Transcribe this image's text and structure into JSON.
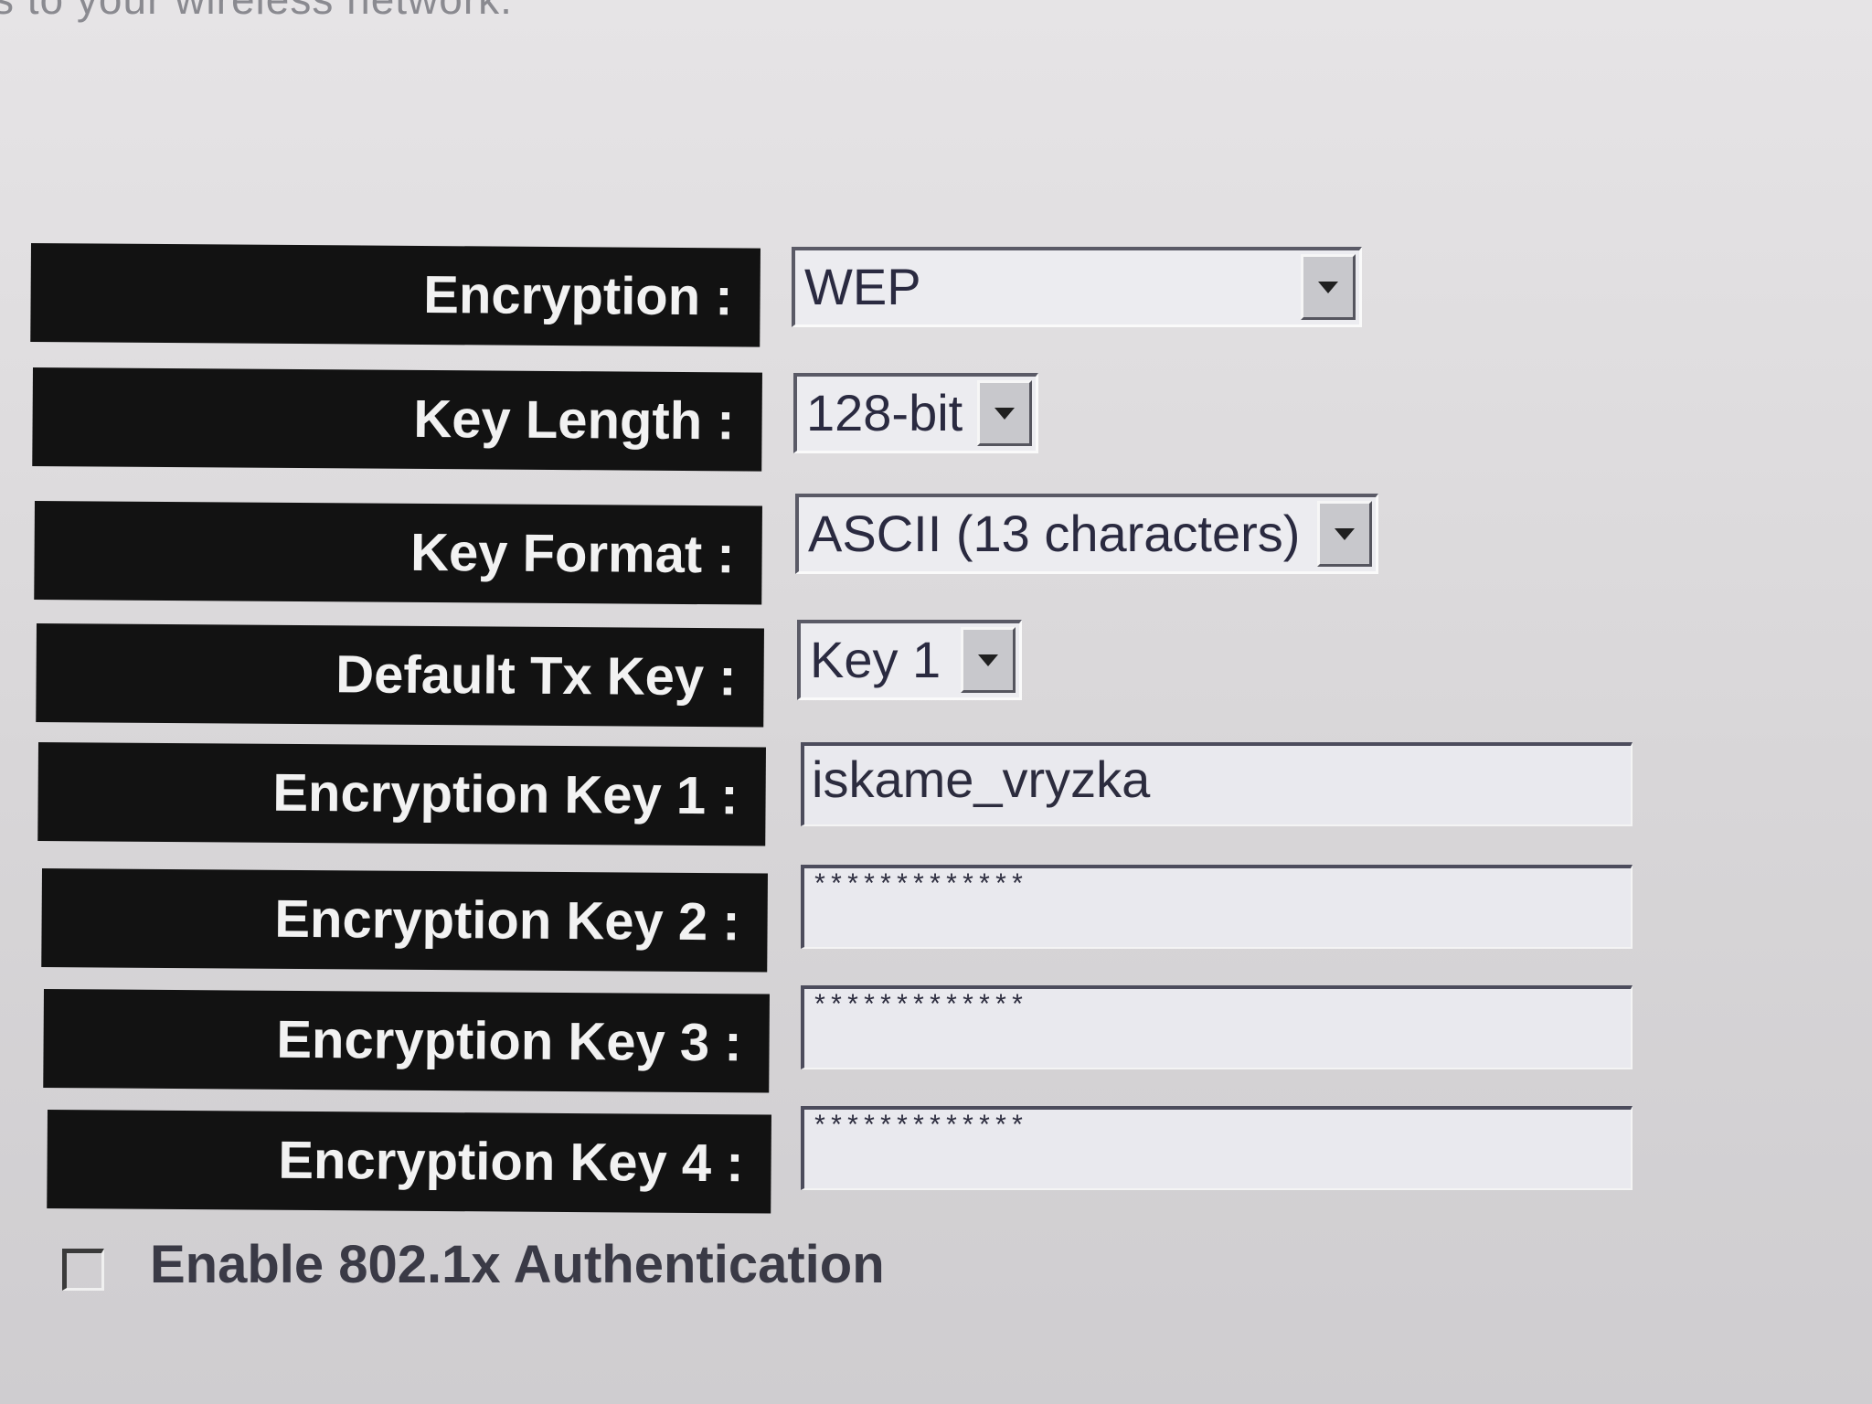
{
  "intro_text": "s to your wireless network.",
  "fields": {
    "encryption": {
      "label": "Encryption :",
      "value": "WEP"
    },
    "key_length": {
      "label": "Key Length :",
      "value": "128-bit"
    },
    "key_format": {
      "label": "Key Format :",
      "value": "ASCII (13 characters)"
    },
    "default_tx_key": {
      "label": "Default Tx Key :",
      "value": "Key 1"
    },
    "encryption_key_1": {
      "label": "Encryption Key 1 :",
      "value": "iskame_vryzka"
    },
    "encryption_key_2": {
      "label": "Encryption Key 2 :",
      "value": "*************"
    },
    "encryption_key_3": {
      "label": "Encryption Key 3 :",
      "value": "*************"
    },
    "encryption_key_4": {
      "label": "Encryption Key 4 :",
      "value": "*************"
    }
  },
  "auth": {
    "label": "Enable 802.1x Authentication",
    "checked": false
  },
  "icons": {
    "dropdown": "chevron-down-icon"
  }
}
